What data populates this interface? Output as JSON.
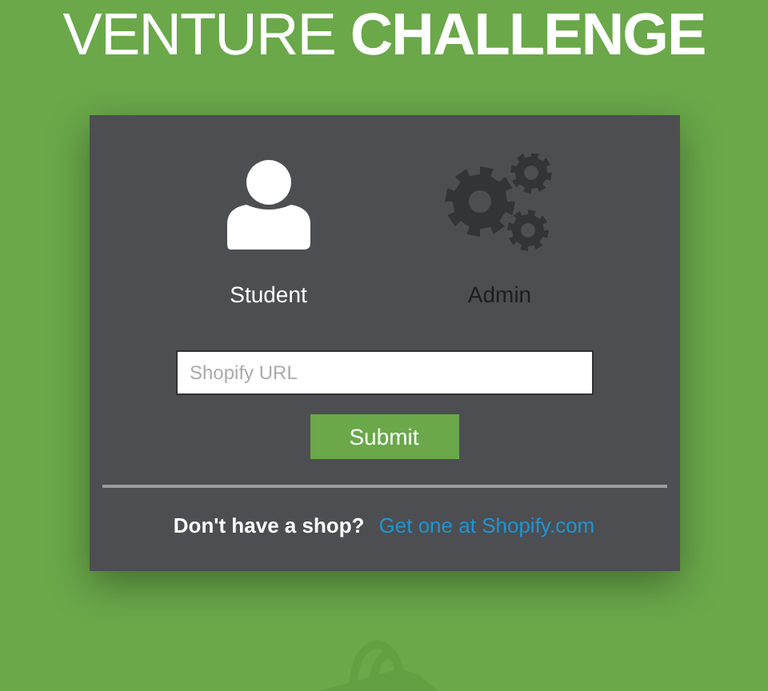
{
  "title": {
    "light": "VENTURE",
    "bold": "CHALLENGE"
  },
  "roles": [
    {
      "kind": "student",
      "label": "Student",
      "selected": true
    },
    {
      "kind": "admin",
      "label": "Admin",
      "selected": false
    }
  ],
  "url_field": {
    "placeholder": "Shopify URL"
  },
  "submit_button": "Submit",
  "footer": {
    "prompt": "Don't have a shop?",
    "link": "Get one at Shopify.com"
  }
}
